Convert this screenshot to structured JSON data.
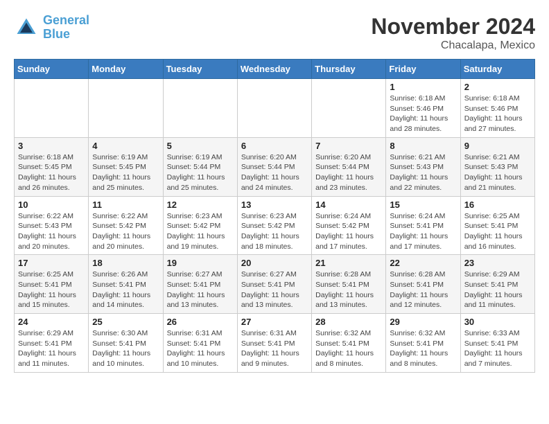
{
  "header": {
    "logo_line1": "General",
    "logo_line2": "Blue",
    "month_title": "November 2024",
    "location": "Chacalapa, Mexico"
  },
  "weekdays": [
    "Sunday",
    "Monday",
    "Tuesday",
    "Wednesday",
    "Thursday",
    "Friday",
    "Saturday"
  ],
  "weeks": [
    [
      {
        "day": "",
        "info": ""
      },
      {
        "day": "",
        "info": ""
      },
      {
        "day": "",
        "info": ""
      },
      {
        "day": "",
        "info": ""
      },
      {
        "day": "",
        "info": ""
      },
      {
        "day": "1",
        "info": "Sunrise: 6:18 AM\nSunset: 5:46 PM\nDaylight: 11 hours and 28 minutes."
      },
      {
        "day": "2",
        "info": "Sunrise: 6:18 AM\nSunset: 5:46 PM\nDaylight: 11 hours and 27 minutes."
      }
    ],
    [
      {
        "day": "3",
        "info": "Sunrise: 6:18 AM\nSunset: 5:45 PM\nDaylight: 11 hours and 26 minutes."
      },
      {
        "day": "4",
        "info": "Sunrise: 6:19 AM\nSunset: 5:45 PM\nDaylight: 11 hours and 25 minutes."
      },
      {
        "day": "5",
        "info": "Sunrise: 6:19 AM\nSunset: 5:44 PM\nDaylight: 11 hours and 25 minutes."
      },
      {
        "day": "6",
        "info": "Sunrise: 6:20 AM\nSunset: 5:44 PM\nDaylight: 11 hours and 24 minutes."
      },
      {
        "day": "7",
        "info": "Sunrise: 6:20 AM\nSunset: 5:44 PM\nDaylight: 11 hours and 23 minutes."
      },
      {
        "day": "8",
        "info": "Sunrise: 6:21 AM\nSunset: 5:43 PM\nDaylight: 11 hours and 22 minutes."
      },
      {
        "day": "9",
        "info": "Sunrise: 6:21 AM\nSunset: 5:43 PM\nDaylight: 11 hours and 21 minutes."
      }
    ],
    [
      {
        "day": "10",
        "info": "Sunrise: 6:22 AM\nSunset: 5:43 PM\nDaylight: 11 hours and 20 minutes."
      },
      {
        "day": "11",
        "info": "Sunrise: 6:22 AM\nSunset: 5:42 PM\nDaylight: 11 hours and 20 minutes."
      },
      {
        "day": "12",
        "info": "Sunrise: 6:23 AM\nSunset: 5:42 PM\nDaylight: 11 hours and 19 minutes."
      },
      {
        "day": "13",
        "info": "Sunrise: 6:23 AM\nSunset: 5:42 PM\nDaylight: 11 hours and 18 minutes."
      },
      {
        "day": "14",
        "info": "Sunrise: 6:24 AM\nSunset: 5:42 PM\nDaylight: 11 hours and 17 minutes."
      },
      {
        "day": "15",
        "info": "Sunrise: 6:24 AM\nSunset: 5:41 PM\nDaylight: 11 hours and 17 minutes."
      },
      {
        "day": "16",
        "info": "Sunrise: 6:25 AM\nSunset: 5:41 PM\nDaylight: 11 hours and 16 minutes."
      }
    ],
    [
      {
        "day": "17",
        "info": "Sunrise: 6:25 AM\nSunset: 5:41 PM\nDaylight: 11 hours and 15 minutes."
      },
      {
        "day": "18",
        "info": "Sunrise: 6:26 AM\nSunset: 5:41 PM\nDaylight: 11 hours and 14 minutes."
      },
      {
        "day": "19",
        "info": "Sunrise: 6:27 AM\nSunset: 5:41 PM\nDaylight: 11 hours and 13 minutes."
      },
      {
        "day": "20",
        "info": "Sunrise: 6:27 AM\nSunset: 5:41 PM\nDaylight: 11 hours and 13 minutes."
      },
      {
        "day": "21",
        "info": "Sunrise: 6:28 AM\nSunset: 5:41 PM\nDaylight: 11 hours and 13 minutes."
      },
      {
        "day": "22",
        "info": "Sunrise: 6:28 AM\nSunset: 5:41 PM\nDaylight: 11 hours and 12 minutes."
      },
      {
        "day": "23",
        "info": "Sunrise: 6:29 AM\nSunset: 5:41 PM\nDaylight: 11 hours and 11 minutes."
      }
    ],
    [
      {
        "day": "24",
        "info": "Sunrise: 6:29 AM\nSunset: 5:41 PM\nDaylight: 11 hours and 11 minutes."
      },
      {
        "day": "25",
        "info": "Sunrise: 6:30 AM\nSunset: 5:41 PM\nDaylight: 11 hours and 10 minutes."
      },
      {
        "day": "26",
        "info": "Sunrise: 6:31 AM\nSunset: 5:41 PM\nDaylight: 11 hours and 10 minutes."
      },
      {
        "day": "27",
        "info": "Sunrise: 6:31 AM\nSunset: 5:41 PM\nDaylight: 11 hours and 9 minutes."
      },
      {
        "day": "28",
        "info": "Sunrise: 6:32 AM\nSunset: 5:41 PM\nDaylight: 11 hours and 8 minutes."
      },
      {
        "day": "29",
        "info": "Sunrise: 6:32 AM\nSunset: 5:41 PM\nDaylight: 11 hours and 8 minutes."
      },
      {
        "day": "30",
        "info": "Sunrise: 6:33 AM\nSunset: 5:41 PM\nDaylight: 11 hours and 7 minutes."
      }
    ]
  ]
}
